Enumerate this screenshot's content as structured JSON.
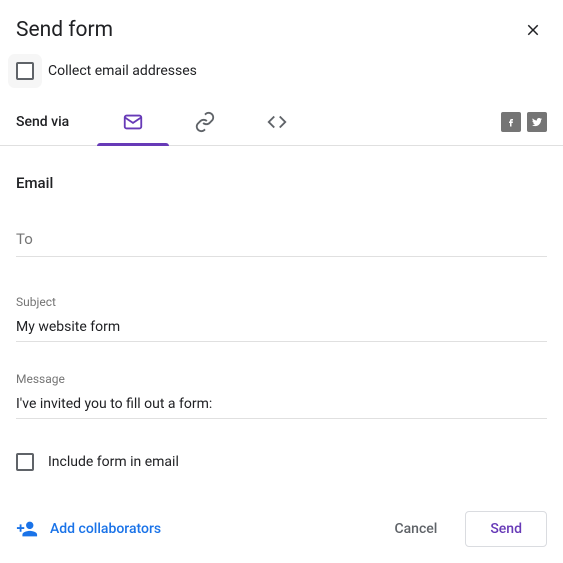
{
  "dialog": {
    "title": "Send form",
    "collect_label": "Collect email addresses",
    "sendvia_label": "Send via"
  },
  "email": {
    "section_title": "Email",
    "to_placeholder": "To",
    "to_value": "",
    "subject_label": "Subject",
    "subject_value": "My website form",
    "message_label": "Message",
    "message_value": "I've invited you to fill out a form:",
    "include_label": "Include form in email"
  },
  "footer": {
    "add_collaborators": "Add collaborators",
    "cancel": "Cancel",
    "send": "Send"
  }
}
